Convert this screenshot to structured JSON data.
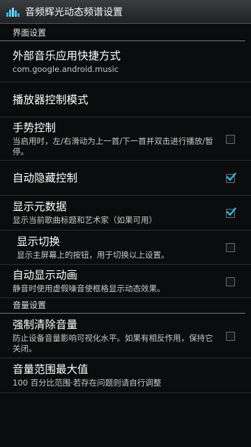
{
  "app": {
    "title": "音频辉光动态频谱设置",
    "icon": "equalizer-icon"
  },
  "sections": [
    {
      "label": "界面设置"
    },
    {
      "label": "音量设置"
    }
  ],
  "prefs": {
    "shortcut": {
      "title": "外部音乐应用快捷方式",
      "summary": "com.google.android.music"
    },
    "player_mode": {
      "title": "播放器控制模式"
    },
    "gesture": {
      "title": "手势控制",
      "summary": "当启用时，左/右滑动为上一首/下一首并双击进行播放/暂停。",
      "checked": false
    },
    "auto_hide": {
      "title": "自动隐藏控制",
      "checked": true
    },
    "metadata": {
      "title": "显示元数据",
      "summary": "显示当前歌曲标题和艺术家（如果可用）",
      "checked": true
    },
    "toggle": {
      "title": "显示切换",
      "summary": "显示主屏幕上的按钮，用于切换以上设置。",
      "checked": false
    },
    "auto_anim": {
      "title": "自动显示动画",
      "summary": "静音时使用虚假噪音使框格显示动态效果。",
      "checked": false
    },
    "force_clear": {
      "title": "强制清除音量",
      "summary": "防止设备音量影响可视化水平。如果有相反作用，保持它关闭。",
      "checked": false
    },
    "range_max": {
      "title": "音量范围最大值",
      "summary": "100 百分比范围·若存在问题则请自行调整"
    }
  },
  "colors": {
    "accent": "#33b5e5",
    "background": "#0b0c0d",
    "text": "#ffffff",
    "summary": "#c9c9c9"
  }
}
